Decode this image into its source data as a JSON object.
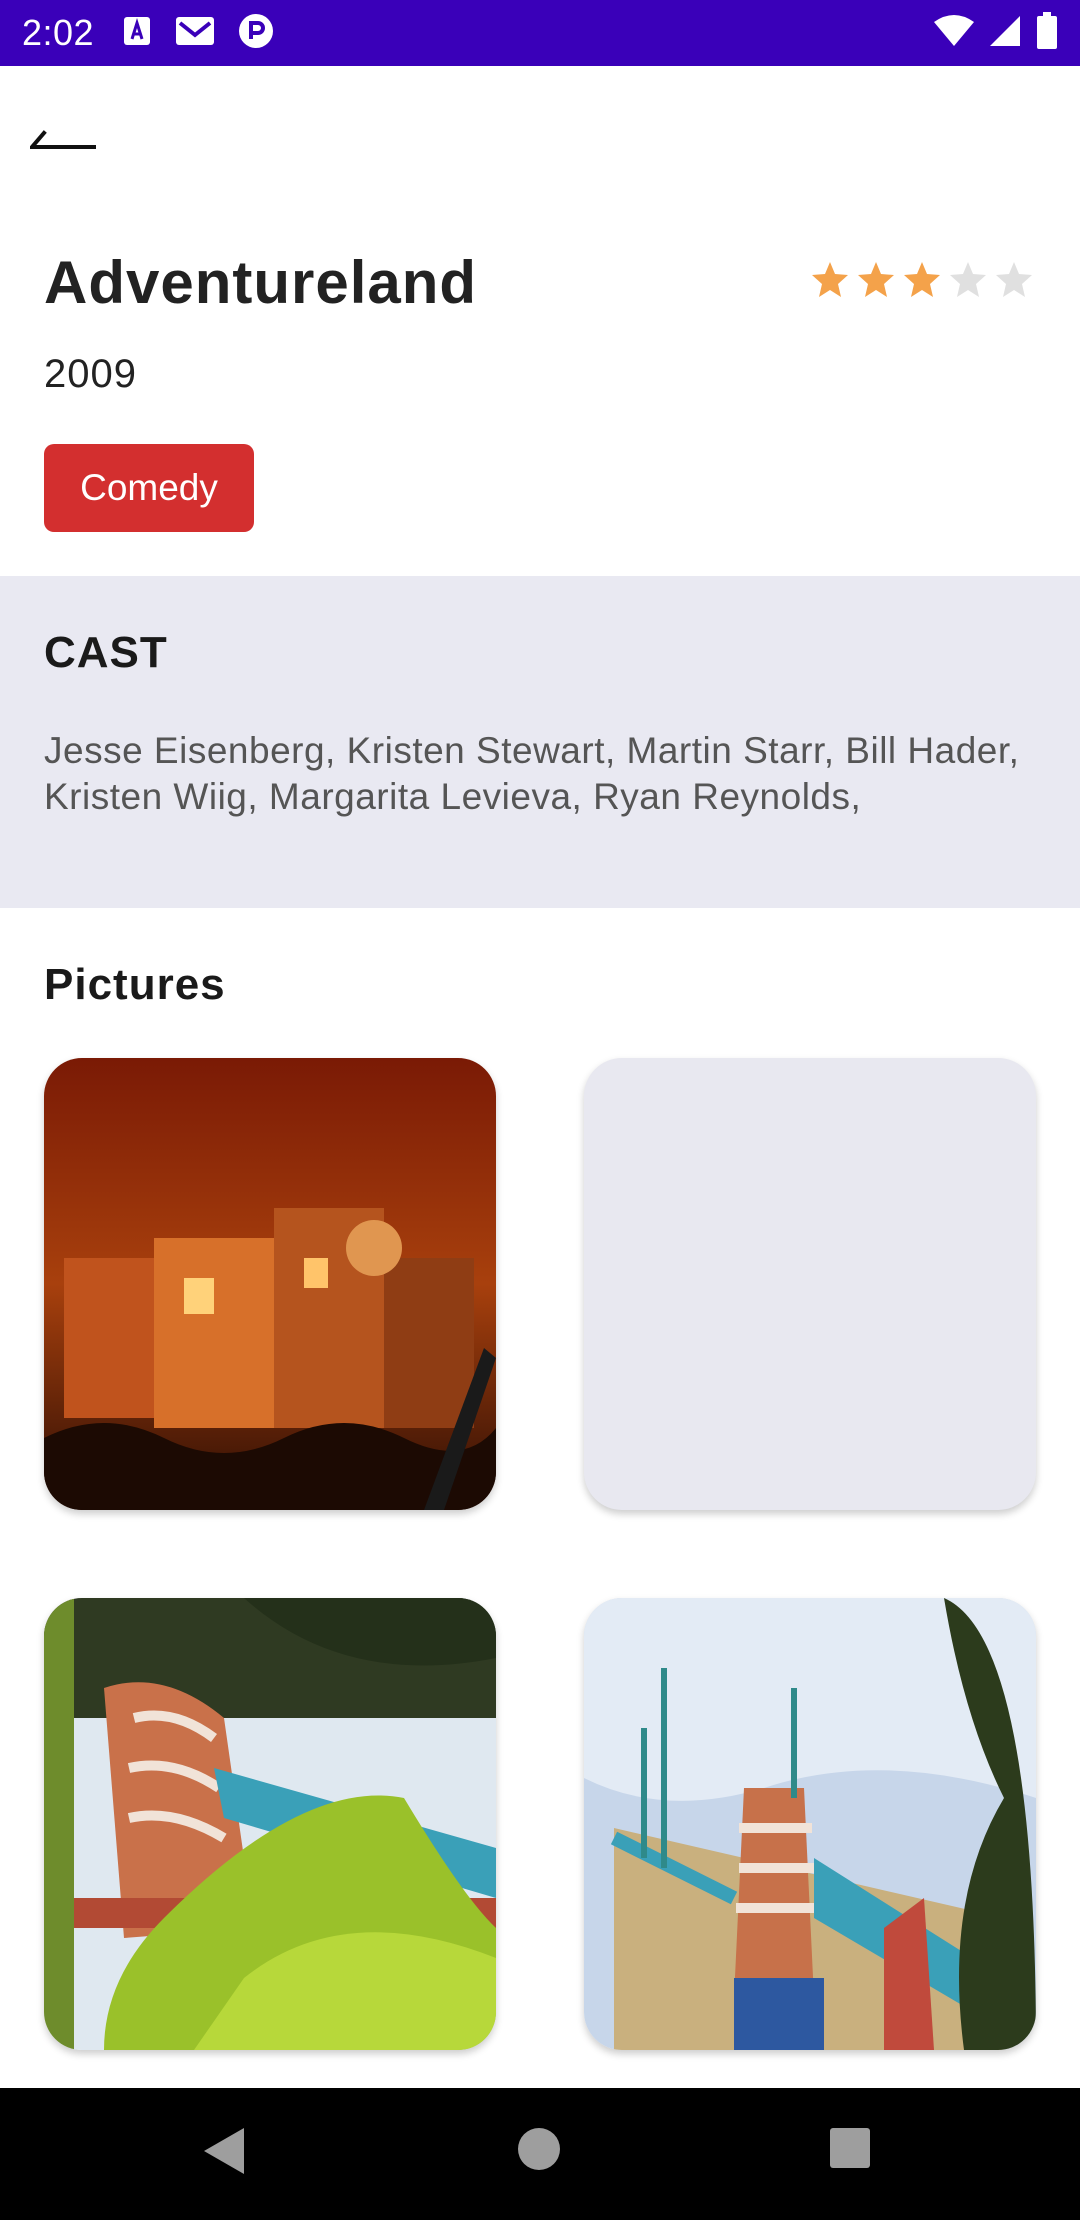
{
  "status_bar": {
    "time": "2:02",
    "left_icons": [
      "a-square-icon",
      "gmail-icon",
      "app-p-icon"
    ],
    "right_icons": [
      "wifi-icon",
      "cell-signal-icon",
      "battery-icon"
    ]
  },
  "movie": {
    "title": "Adventureland",
    "year": "2009",
    "genre": "Comedy",
    "rating": 3,
    "rating_max": 5
  },
  "cast": {
    "heading": "CAST",
    "names": "Jesse Eisenberg, Kristen Stewart, Martin Starr, Bill Hader, Kristen Wiig, Margarita Levieva, Ryan Reynolds,"
  },
  "pictures": {
    "heading": "Pictures"
  },
  "colors": {
    "status_bar": "#3a00b9",
    "star_filled": "#f4a24a",
    "star_empty": "#e0e0e0",
    "genre_chip": "#d32f2f",
    "cast_background": "#e9e9f2"
  }
}
